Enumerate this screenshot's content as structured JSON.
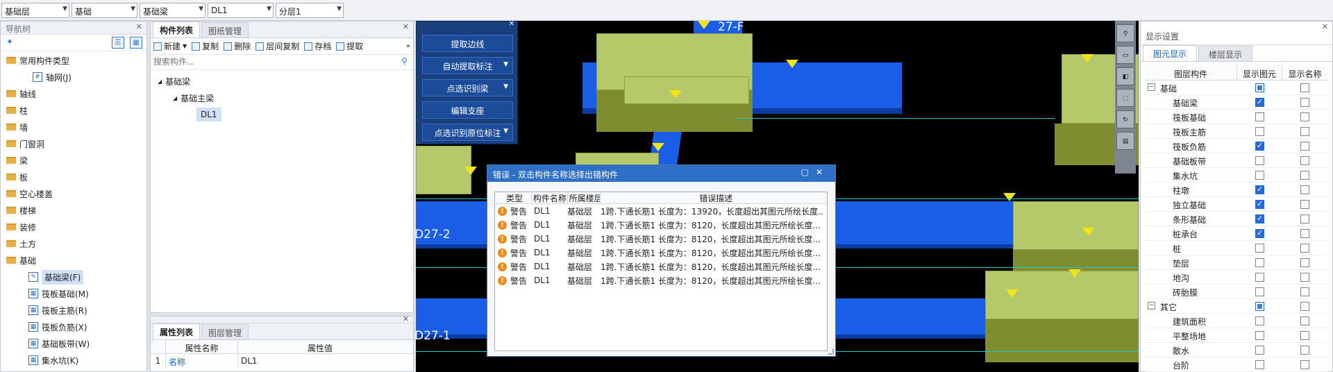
{
  "combos": [
    {
      "value": "基础层",
      "width": 98
    },
    {
      "value": "基础",
      "width": 95
    },
    {
      "value": "基础梁",
      "width": 95
    },
    {
      "value": "DL1",
      "width": 95
    },
    {
      "value": "分层1",
      "width": 98
    }
  ],
  "nav": {
    "title": "导航树",
    "tree": [
      {
        "label": "常用构件类型",
        "level": 0,
        "icon": "folder-icon",
        "selected": false
      },
      {
        "label": "轴网(J)",
        "level": 2,
        "icon": "axis-grid-icon",
        "selected": false
      },
      {
        "label": "轴线",
        "level": 0,
        "icon": "folder-icon",
        "selected": false
      },
      {
        "label": "柱",
        "level": 0,
        "icon": "folder-icon",
        "selected": false
      },
      {
        "label": "墙",
        "level": 0,
        "icon": "folder-icon",
        "selected": false
      },
      {
        "label": "门窗洞",
        "level": 0,
        "icon": "folder-icon",
        "selected": false
      },
      {
        "label": "梁",
        "level": 0,
        "icon": "folder-icon",
        "selected": false
      },
      {
        "label": "板",
        "level": 0,
        "icon": "folder-icon",
        "selected": false
      },
      {
        "label": "空心楼盖",
        "level": 0,
        "icon": "folder-icon",
        "selected": false
      },
      {
        "label": "楼梯",
        "level": 0,
        "icon": "folder-icon",
        "selected": false
      },
      {
        "label": "装修",
        "level": 0,
        "icon": "folder-icon",
        "selected": false
      },
      {
        "label": "土方",
        "level": 0,
        "icon": "folder-icon",
        "selected": false
      },
      {
        "label": "基础",
        "level": 0,
        "icon": "folder-icon",
        "selected": false
      },
      {
        "label": "基础梁(F)",
        "level": 1,
        "icon": "pencil-icon",
        "selected": true
      },
      {
        "label": "筏板基础(M)",
        "level": 1,
        "icon": "raft-icon",
        "selected": false
      },
      {
        "label": "筏板主筋(R)",
        "level": 1,
        "icon": "rebar-icon",
        "selected": false
      },
      {
        "label": "筏板负筋(X)",
        "level": 1,
        "icon": "rebar-icon",
        "selected": false
      },
      {
        "label": "基础板带(W)",
        "level": 1,
        "icon": "strip-icon",
        "selected": false
      },
      {
        "label": "集水坑(K)",
        "level": 1,
        "icon": "pit-icon",
        "selected": false
      }
    ]
  },
  "comp": {
    "tabs": [
      "构件列表",
      "图纸管理"
    ],
    "toolbar": [
      "新建",
      "复制",
      "删除",
      "层间复制",
      "存档",
      "提取"
    ],
    "search_placeholder": "搜索构件...",
    "tree": [
      {
        "label": "基础梁",
        "level": 0
      },
      {
        "label": "基础主梁",
        "level": 1
      },
      {
        "label": "DL1",
        "level": 2,
        "selected": true
      }
    ]
  },
  "props": {
    "tabs": [
      "属性列表",
      "图层管理"
    ],
    "columns": [
      "属性名称",
      "属性值"
    ],
    "rows": [
      {
        "num": "1",
        "name": "名称",
        "value": "DL1"
      }
    ]
  },
  "float_panel": {
    "buttons": [
      {
        "label": "提取边线",
        "dropdown": false
      },
      {
        "label": "自动提取标注",
        "dropdown": true
      },
      {
        "label": "点选识别梁",
        "dropdown": true
      },
      {
        "label": "编辑支座",
        "dropdown": false
      },
      {
        "label": "点选识别原位标注",
        "dropdown": true
      }
    ]
  },
  "viewport": {
    "labels": [
      "27-F",
      "D27-2",
      "D27-1"
    ]
  },
  "error_dialog": {
    "title": "错误 - 双击构件名称选择出错构件",
    "columns": [
      "类型",
      "构件名称",
      "所属楼层",
      "错误描述"
    ],
    "rows": [
      {
        "type": "警告",
        "name": "DL1",
        "floor": "基础层",
        "desc": "1跨.下通长筋1 长度为：13920，长度超出其图元所绘长度..."
      },
      {
        "type": "警告",
        "name": "DL1",
        "floor": "基础层",
        "desc": "1跨.下通长筋1 长度为：8120，长度超出其图元所绘长度..."
      },
      {
        "type": "警告",
        "name": "DL1",
        "floor": "基础层",
        "desc": "1跨.下通长筋1 长度为：8120，长度超出其图元所绘长度..."
      },
      {
        "type": "警告",
        "name": "DL1",
        "floor": "基础层",
        "desc": "1跨.下通长筋1 长度为：8120，长度超出其图元所绘长度..."
      },
      {
        "type": "警告",
        "name": "DL1",
        "floor": "基础层",
        "desc": "1跨.下通长筋1 长度为：8120，长度超出其图元所绘长度..."
      },
      {
        "type": "警告",
        "name": "DL1",
        "floor": "基础层",
        "desc": "1跨.下通长筋1 长度为：8120，长度超出其图元所绘长度..."
      }
    ]
  },
  "display": {
    "title": "显示设置",
    "tabs": [
      "图元显示",
      "楼层显示"
    ],
    "columns": [
      "图层构件",
      "显示图元",
      "显示名称"
    ],
    "rows": [
      {
        "label": "基础",
        "group": true,
        "show": "part",
        "name": false
      },
      {
        "label": "基础梁",
        "group": false,
        "show": true,
        "name": false
      },
      {
        "label": "筏板基础",
        "group": false,
        "show": false,
        "name": false
      },
      {
        "label": "筏板主筋",
        "group": false,
        "show": false,
        "name": false
      },
      {
        "label": "筏板负筋",
        "group": false,
        "show": true,
        "name": false
      },
      {
        "label": "基础板带",
        "group": false,
        "show": false,
        "name": false
      },
      {
        "label": "集水坑",
        "group": false,
        "show": false,
        "name": false
      },
      {
        "label": "柱墩",
        "group": false,
        "show": true,
        "name": false
      },
      {
        "label": "独立基础",
        "group": false,
        "show": true,
        "name": false
      },
      {
        "label": "条形基础",
        "group": false,
        "show": true,
        "name": false
      },
      {
        "label": "桩承台",
        "group": false,
        "show": true,
        "name": false
      },
      {
        "label": "桩",
        "group": false,
        "show": false,
        "name": false
      },
      {
        "label": "垫层",
        "group": false,
        "show": false,
        "name": false
      },
      {
        "label": "地沟",
        "group": false,
        "show": false,
        "name": false
      },
      {
        "label": "砖胎膜",
        "group": false,
        "show": false,
        "name": false
      },
      {
        "label": "其它",
        "group": true,
        "show": "part",
        "name": false
      },
      {
        "label": "建筑面积",
        "group": false,
        "show": false,
        "name": false
      },
      {
        "label": "平整场地",
        "group": false,
        "show": false,
        "name": false
      },
      {
        "label": "散水",
        "group": false,
        "show": false,
        "name": false
      },
      {
        "label": "台阶",
        "group": false,
        "show": false,
        "name": false
      }
    ]
  }
}
